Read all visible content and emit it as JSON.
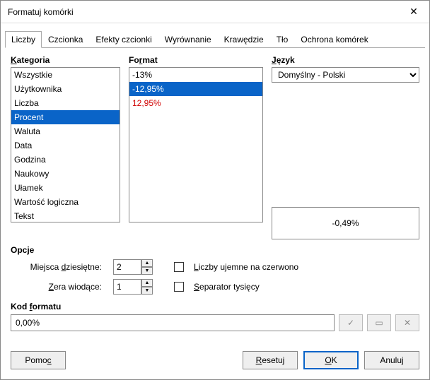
{
  "title": "Formatuj komórki",
  "tabs": [
    "Liczby",
    "Czcionka",
    "Efekty czcionki",
    "Wyrównanie",
    "Krawędzie",
    "Tło",
    "Ochrona komórek"
  ],
  "active_tab": 0,
  "headers": {
    "category": "Kategoria",
    "format": "Format",
    "language": "Język",
    "options": "Opcje",
    "code": "Kod formatu"
  },
  "categories": [
    "Wszystkie",
    "Użytkownika",
    "Liczba",
    "Procent",
    "Waluta",
    "Data",
    "Godzina",
    "Naukowy",
    "Ułamek",
    "Wartość logiczna",
    "Tekst"
  ],
  "category_selected": 3,
  "formats": [
    {
      "text": "-13%",
      "selected": false,
      "red": false
    },
    {
      "text": "-12,95%",
      "selected": true,
      "red": false
    },
    {
      "text": "12,95%",
      "selected": false,
      "red": true
    }
  ],
  "language": {
    "value": "Domyślny - Polski"
  },
  "preview": "-0,49%",
  "options": {
    "decimal_label": "Miejsca dziesiętne:",
    "decimal_value": "2",
    "leading_label": "Zera wiodące:",
    "leading_value": "1",
    "neg_red_label": "Liczby ujemne na czerwono",
    "neg_red_checked": false,
    "thousands_label": "Separator tysięcy",
    "thousands_checked": false
  },
  "format_code": "0,00%",
  "buttons": {
    "help": "Pomoc",
    "reset": "Resetuj",
    "ok": "OK",
    "cancel": "Anuluj"
  }
}
